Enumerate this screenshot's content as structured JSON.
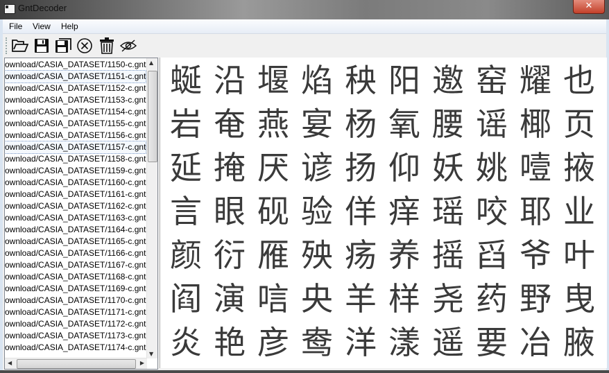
{
  "window": {
    "title": "GntDecoder",
    "close_glyph": "✕"
  },
  "menu": [
    "File",
    "View",
    "Help"
  ],
  "toolbar": [
    {
      "name": "open-folder-icon"
    },
    {
      "name": "save-icon"
    },
    {
      "name": "save-all-icon"
    },
    {
      "name": "cancel-icon"
    },
    {
      "name": "delete-icon"
    },
    {
      "name": "hide-icon"
    }
  ],
  "file_list": {
    "items": [
      "ownload/CASIA_DATASET/1150-c.gnt",
      "ownload/CASIA_DATASET/1151-c.gnt",
      "ownload/CASIA_DATASET/1152-c.gnt",
      "ownload/CASIA_DATASET/1153-c.gnt",
      "ownload/CASIA_DATASET/1154-c.gnt",
      "ownload/CASIA_DATASET/1155-c.gnt",
      "ownload/CASIA_DATASET/1156-c.gnt",
      "ownload/CASIA_DATASET/1157-c.gnt",
      "ownload/CASIA_DATASET/1158-c.gnt",
      "ownload/CASIA_DATASET/1159-c.gnt",
      "ownload/CASIA_DATASET/1160-c.gnt",
      "ownload/CASIA_DATASET/1161-c.gnt",
      "ownload/CASIA_DATASET/1162-c.gnt",
      "ownload/CASIA_DATASET/1163-c.gnt",
      "ownload/CASIA_DATASET/1164-c.gnt",
      "ownload/CASIA_DATASET/1165-c.gnt",
      "ownload/CASIA_DATASET/1166-c.gnt",
      "ownload/CASIA_DATASET/1167-c.gnt",
      "ownload/CASIA_DATASET/1168-c.gnt",
      "ownload/CASIA_DATASET/1169-c.gnt",
      "ownload/CASIA_DATASET/1170-c.gnt",
      "ownload/CASIA_DATASET/1171-c.gnt",
      "ownload/CASIA_DATASET/1172-c.gnt",
      "ownload/CASIA_DATASET/1173-c.gnt",
      "ownload/CASIA_DATASET/1174-c.gnt"
    ],
    "selected_indices": [
      1,
      7
    ]
  },
  "characters": [
    [
      "蜒",
      "沿",
      "堰",
      "焰",
      "秧",
      "阳",
      "邀",
      "窑",
      "耀",
      "也"
    ],
    [
      "岩",
      "奄",
      "燕",
      "宴",
      "杨",
      "氧",
      "腰",
      "谣",
      "椰",
      "页"
    ],
    [
      "延",
      "掩",
      "厌",
      "谚",
      "扬",
      "仰",
      "妖",
      "姚",
      "噎",
      "掖"
    ],
    [
      "言",
      "眼",
      "砚",
      "验",
      "佯",
      "痒",
      "瑶",
      "咬",
      "耶",
      "业"
    ],
    [
      "颜",
      "衍",
      "雁",
      "殃",
      "疡",
      "养",
      "摇",
      "舀",
      "爷",
      "叶"
    ],
    [
      "阎",
      "演",
      "唁",
      "央",
      "羊",
      "样",
      "尧",
      "药",
      "野",
      "曳"
    ],
    [
      "炎",
      "艳",
      "彦",
      "鸯",
      "洋",
      "漾",
      "遥",
      "要",
      "冶",
      "腋"
    ]
  ]
}
